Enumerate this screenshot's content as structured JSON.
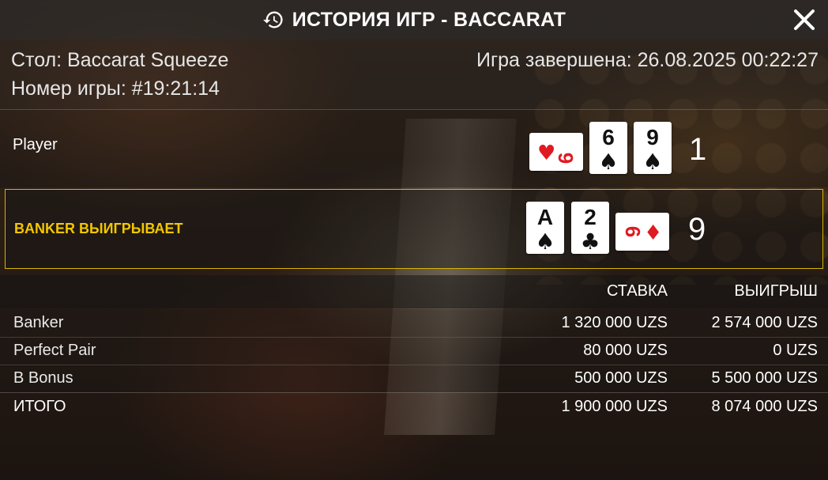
{
  "header": {
    "title": "ИСТОРИЯ ИГР - BACCARAT",
    "history_icon": "history-icon",
    "close_icon": "close-icon"
  },
  "info": {
    "table": "Стол: Baccarat Squeeze",
    "game_number": "Номер игры: #19:21:14",
    "finished": "Игра завершена: 26.08.2025 00:22:27"
  },
  "player": {
    "label": "Player",
    "score": "1",
    "cards": [
      {
        "rank": "9",
        "suit": "♥",
        "color": "#e01a22",
        "orientation": "landscape"
      },
      {
        "rank": "6",
        "suit": "♠",
        "color": "#111111",
        "orientation": "portrait"
      },
      {
        "rank": "9",
        "suit": "♠",
        "color": "#111111",
        "orientation": "portrait"
      }
    ]
  },
  "banker": {
    "label": "BANKER ВЫИГРЫВАЕТ",
    "score": "9",
    "cards": [
      {
        "rank": "A",
        "suit": "♠",
        "color": "#111111",
        "orientation": "portrait"
      },
      {
        "rank": "2",
        "suit": "♣",
        "color": "#111111",
        "orientation": "portrait"
      },
      {
        "rank": "6",
        "suit": "♦",
        "color": "#e01a22",
        "orientation": "landscape"
      }
    ]
  },
  "bets_table": {
    "col_bet": "СТАВКА",
    "col_win": "ВЫИГРЫШ",
    "rows": [
      {
        "name": "Banker",
        "bet": "1 320 000 UZS",
        "win": "2 574 000 UZS"
      },
      {
        "name": "Perfect Pair",
        "bet": "80 000 UZS",
        "win": "0 UZS"
      },
      {
        "name": "B Bonus",
        "bet": "500 000 UZS",
        "win": "5 500 000 UZS"
      }
    ],
    "total": {
      "name": "ИТОГО",
      "bet": "1 900 000 UZS",
      "win": "8 074 000 UZS"
    }
  },
  "colors": {
    "winner_accent": "#f2c700",
    "red_suit": "#e01a22"
  }
}
